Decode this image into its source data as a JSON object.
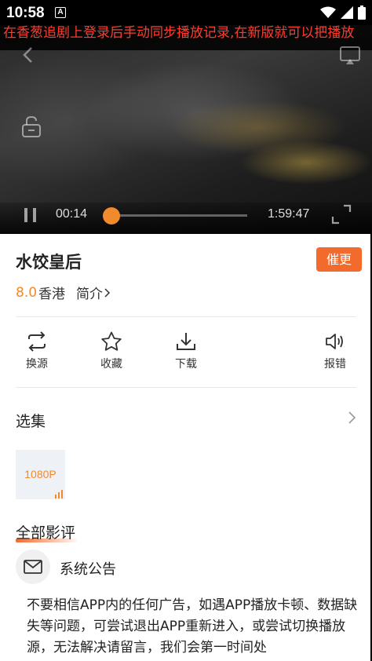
{
  "status_bar": {
    "time": "10:58",
    "notification_badge": "A",
    "icons": [
      "wifi-icon",
      "signal-icon",
      "battery-icon"
    ]
  },
  "player": {
    "marquee_text": "在香葱追剧上登录后手动同步播放记录,在新版就可以把播放",
    "current_time": "00:14",
    "total_time": "1:59:47",
    "progress": 0.0019,
    "accent_color": "#f08a2c"
  },
  "movie": {
    "title": "水饺皇后",
    "urge_button": "催更",
    "rating": "8.0",
    "region": "香港",
    "intro_label": "简介"
  },
  "actions": [
    {
      "label": "换源",
      "icon": "switch-source-icon"
    },
    {
      "label": "收藏",
      "icon": "star-icon"
    },
    {
      "label": "下载",
      "icon": "download-icon"
    },
    {
      "label": "报错",
      "icon": "speaker-icon"
    }
  ],
  "episodes": {
    "title": "选集",
    "items": [
      "1080P"
    ]
  },
  "reviews": {
    "title": "全部影评",
    "notice_author": "系统公告",
    "notice_text": "不要相信APP内的任何广告，如遇APP播放卡顿、数据缺失等问题，可尝试退出APP重新进入，或尝试切换播放源，无法解决请留言，我们会第一时间处"
  }
}
